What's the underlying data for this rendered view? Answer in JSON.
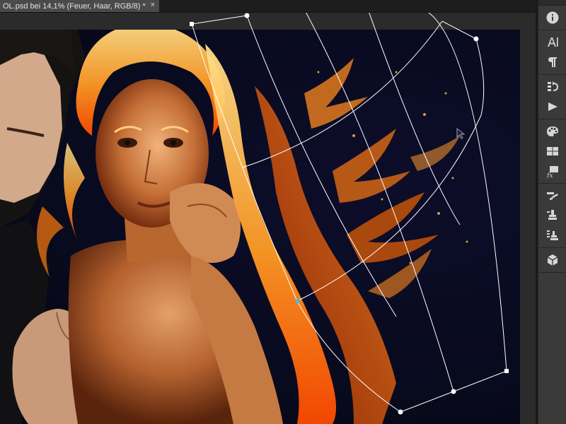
{
  "document_tab": {
    "title": "OL.psd bei 14,1% (Feuer, Haar, RGB/8) *",
    "close_symbol": "×"
  },
  "colors": {
    "app_background": "#282828",
    "panel_background": "#3a3a3a",
    "canvas_background": "#080a1e",
    "warp_grid": "#ffffff",
    "fire_orange": "#ff8a1e",
    "active_anchor": "#5fb5c8"
  },
  "panel_tools": [
    {
      "name": "info-icon",
      "label": "Info"
    },
    {
      "name": "character-icon",
      "label": "Zeichen"
    },
    {
      "name": "paragraph-icon",
      "label": "Absatz"
    },
    {
      "name": "history-icon",
      "label": "Protokoll"
    },
    {
      "name": "actions-play-icon",
      "label": "Aktionen"
    },
    {
      "name": "color-palette-icon",
      "label": "Farbe"
    },
    {
      "name": "swatches-icon",
      "label": "Farbfelder"
    },
    {
      "name": "styles-fx-icon",
      "label": "Stile"
    },
    {
      "name": "brush-presets-icon",
      "label": "Pinselvorgaben"
    },
    {
      "name": "clone-source-icon",
      "label": "Kopierquelle"
    },
    {
      "name": "tool-presets-icon",
      "label": "Werkzeugvorgaben"
    },
    {
      "name": "3d-cube-icon",
      "label": "3D"
    }
  ],
  "canvas": {
    "subject": "photo-manipulation-fire-woman-and-man"
  }
}
